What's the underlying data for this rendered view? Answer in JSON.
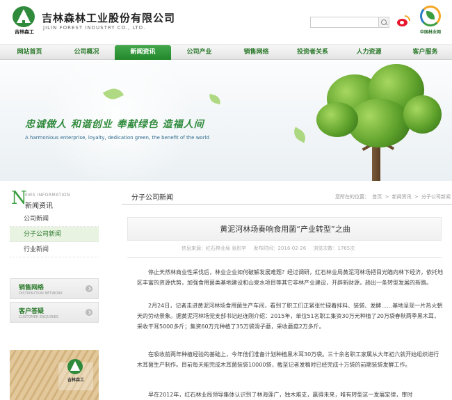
{
  "header": {
    "logo_text": "吉林森工",
    "company_cn": "吉林森林工业股份有限公司",
    "company_en": "JILIN FOREST INDUSTRY CO., LTD.",
    "forestry_logo_text": "中国林业网"
  },
  "nav": {
    "items": [
      "网站首页",
      "公司概况",
      "新闻资讯",
      "公司产业",
      "销售网络",
      "投资者关系",
      "人力资源",
      "客户服务"
    ],
    "active_index": 2
  },
  "banner": {
    "slogan": "忠诚做人 和谐创业 奉献绿色 造福人间",
    "slogan_en": "A harmonious enterprise, loyalty, dedication green, the benefit of the world"
  },
  "sidebar": {
    "head_letter": "N",
    "head_en": "EWS INFORMATION",
    "head_cn": "新闻资讯",
    "items": [
      "公司新闻",
      "分子公司新闻",
      "行业新闻"
    ],
    "active_index": 1,
    "sales_title": "销售网络",
    "sales_sub": "DISTRIBUTION NETWORK",
    "customer_title": "客户答疑",
    "customer_sub": "CUSTOMER ENQUIRIES",
    "photo_text": "吉林森工"
  },
  "main": {
    "section_title": "分子公司新闻",
    "breadcrumb": [
      "您所在的位置：",
      "首页",
      ">",
      "新闻资讯",
      ">",
      "分子公司新闻"
    ],
    "article_title": "黄泥河林场奏响食用菌“产业转型”之曲",
    "meta_source": "信息来源：红石林业局 张彤宇",
    "meta_date": "发布时间：2016-02-26",
    "meta_views": "浏览次数：1765次",
    "paragraphs": [
      "停止天然林商业性采伐后，林业企业如何破解发展难题？经过调研，红石林业局黄泥河林场把目光瞄向林下经济，依托地区丰富的资源优势，加强食用菌类基地建设和山泉水项目等其它非林产业建设，开辟新财源，趟出一条转型发展的新路。",
      "2月24日，记者走进黄泥河林场食用菌生产车间，看到了职工们正紧张忙碌着拌料、装袋、发酵……基地呈现一片热火朝天的劳动景象。据黄泥河林场党支部书记赵连刚介绍：2015年，单位51名职工集资30万元种植了20万袋春秋两季黑木耳，采收干耳5000多斤；集资60万元种植了35万袋滑子蘑，采收蘑菇2万多斤。",
      "在吸收前两年种植经验的基础上，今年他们准备计划种植黑木耳30万袋。三十余名职工家属从大年初六就开始组织进行木耳菌生产制作。目前每天能完成木耳菌装袋10000袋，截至记者发稿时已经完成十万袋的前期装袋发酵工作。",
      "早在2012年，红石林业局领导集体认识到了林海莲广，独木难支，赢得未来，唯有转型这一发展定律，审时"
    ]
  }
}
